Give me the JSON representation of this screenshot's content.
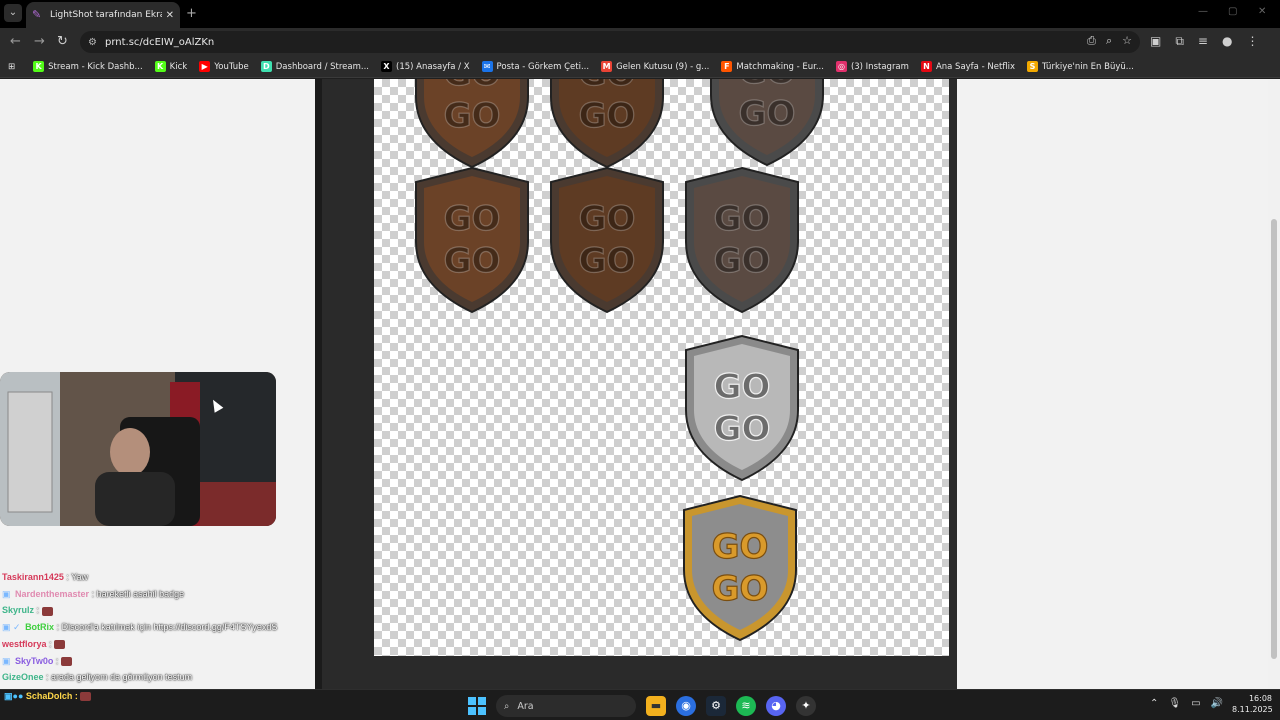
{
  "browser": {
    "tab": {
      "title": "LightShot tarafından Ekran Görüntüsü",
      "close": "✕"
    },
    "new_tab": "+",
    "url": "prnt.sc/dcEIW_oAlZKn",
    "bookmarks": [
      {
        "label": "Stream - Kick Dashb...",
        "icon_color": "#53fc18",
        "glyph": "K"
      },
      {
        "label": "Kick",
        "icon_color": "#53fc18",
        "glyph": "K"
      },
      {
        "label": "YouTube",
        "icon_color": "#ff0000",
        "glyph": "▶"
      },
      {
        "label": "Dashboard / Stream...",
        "icon_color": "#3fe0b0",
        "glyph": "D"
      },
      {
        "label": "(15) Anasayfa / X",
        "icon_color": "#000000",
        "glyph": "X"
      },
      {
        "label": "Posta - Görkem Çeti...",
        "icon_color": "#1a73e8",
        "glyph": "✉"
      },
      {
        "label": "Gelen Kutusu (9) - g...",
        "icon_color": "#ea4335",
        "glyph": "M"
      },
      {
        "label": "Matchmaking - Eur...",
        "icon_color": "#ff5500",
        "glyph": "F"
      },
      {
        "label": "(3) Instagram",
        "icon_color": "#e1306c",
        "glyph": "◎"
      },
      {
        "label": "Ana Sayfa - Netflix",
        "icon_color": "#e50914",
        "glyph": "N"
      },
      {
        "label": "Türkiye'nin En Büyü...",
        "icon_color": "#f2a900",
        "glyph": "S"
      }
    ]
  },
  "screenshot": {
    "badges": [
      {
        "text1": "GO",
        "text2": "GO",
        "color": "#6b4227",
        "rim": "#4a3a30"
      },
      {
        "text1": "GO",
        "text2": "GO",
        "color": "#5e3b23",
        "rim": "#4a3a30"
      },
      {
        "text1": "GO",
        "text2": "GO",
        "color": "#5a4a42",
        "rim": "#4a4a4a"
      },
      {
        "text1": "GO",
        "text2": "GO",
        "color": "#b8b8b8",
        "rim": "#8a8a8a"
      },
      {
        "text1": "GO",
        "text2": "GO",
        "color": "#8d8d8d",
        "rim": "#c9962e"
      }
    ]
  },
  "chat": [
    {
      "user": "Taskirann1425",
      "color": "#d63a5a",
      "badge": "",
      "msg": "Yaw",
      "emote": false
    },
    {
      "user": "Nardenthemaster",
      "color": "#e08ab0",
      "badge": "▣",
      "msg": "hareketli asahil badge",
      "emote": false
    },
    {
      "user": "Skyrulz",
      "color": "#3fb58a",
      "badge": "",
      "msg": "",
      "emote": true
    },
    {
      "user": "BotRix",
      "color": "#3fcf3f",
      "badge": "▣ ✓",
      "msg": "Discord'a katılmak için https://discord.gg/F4TSYyexdS",
      "emote": false
    },
    {
      "user": "westflorya",
      "color": "#d63a5a",
      "badge": "",
      "msg": "",
      "emote": true
    },
    {
      "user": "SkyTw0o",
      "color": "#8a5ee0",
      "badge": "▣",
      "msg": "",
      "emote": true
    },
    {
      "user": "GizeOnee",
      "color": "#3fb58a",
      "badge": "",
      "msg": "arada geliyom da görmüyon testum",
      "emote": false
    }
  ],
  "taskbar": {
    "user": "SchaDolch",
    "search": "Ara",
    "time": "16:08",
    "date": "8.11.2025"
  }
}
